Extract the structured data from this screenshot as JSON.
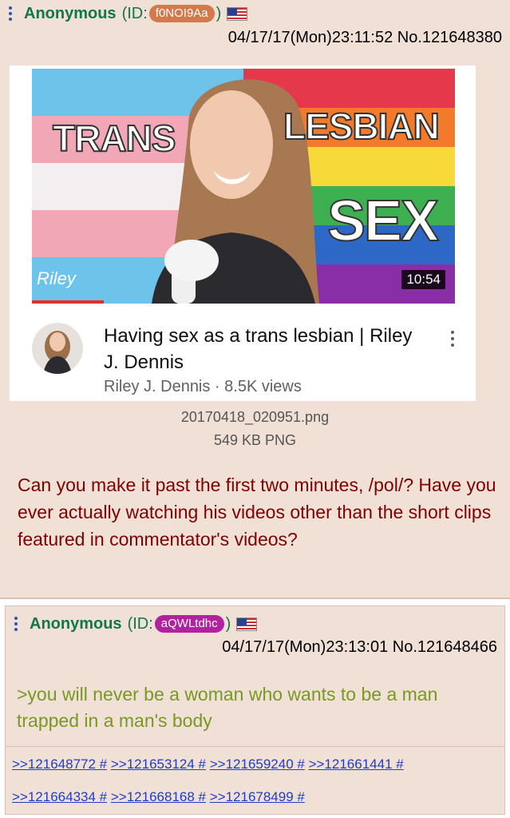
{
  "post1": {
    "name": "Anonymous",
    "id_label": "(ID:",
    "id": "f0NOI9Aa",
    "id_color": "#d47a4a",
    "id_close": ")",
    "datetime": "04/17/17(Mon)23:11:52",
    "post_no": "No.121648380",
    "flag": "us-flag-icon",
    "thumbnail": {
      "overlay_left": "TRANS",
      "overlay_right": "LESBIAN",
      "overlay_bottom": "SEX",
      "logo": "Riley",
      "duration": "10:54",
      "video_title": "Having sex as a trans lesbian | Riley J. Dennis",
      "channel_line": "Riley J. Dennis · 8.5K views"
    },
    "file_name": "20170418_020951.png",
    "file_size": "549 KB PNG",
    "body": "Can you make it past the first two minutes, /pol/? Have you ever actually watching his videos other than the short clips featured in commentator's videos?"
  },
  "post2": {
    "name": "Anonymous",
    "id_label": "(ID:",
    "id": "aQWLtdhc",
    "id_color": "#b1229e",
    "id_close": ")",
    "datetime": "04/17/17(Mon)23:13:01",
    "post_no": "No.121648466",
    "flag": "us-flag-icon",
    "greentext": ">you will never be a woman who wants to be a man trapped in a man's body",
    "replies": [
      ">>121648772 #",
      ">>121653124 #",
      ">>121659240 #",
      ">>121661441 #",
      ">>121664334 #",
      ">>121668168 #",
      ">>121678499 #"
    ]
  }
}
